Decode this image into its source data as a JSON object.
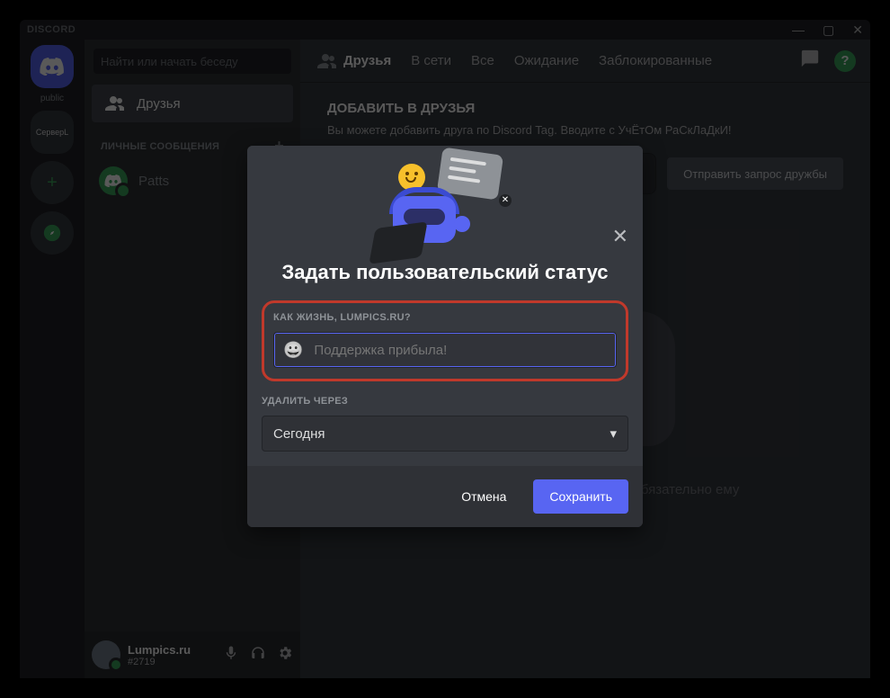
{
  "window": {
    "app_name": "DISCORD"
  },
  "guilds": {
    "home_label": "public",
    "server1": "СерверL"
  },
  "sidebar": {
    "search_placeholder": "Найти или начать беседу",
    "friends_label": "Друзья",
    "dm_header": "ЛИЧНЫЕ СООБЩЕНИЯ",
    "dm_items": [
      {
        "name": "Patts"
      }
    ]
  },
  "user": {
    "username": "Lumpics.ru",
    "tag": "#2719"
  },
  "topbar": {
    "friends": "Друзья",
    "online": "В сети",
    "all": "Все",
    "pending": "Ожидание",
    "blocked": "Заблокированные"
  },
  "add_friend": {
    "title": "ДОБАВИТЬ В ДРУЗЬЯ",
    "subtitle": "Вы можете добавить друга по Discord Tag. Вводите с УчЁтОм РаСкЛаДкИ!",
    "send_btn": "Отправить запрос дружбы"
  },
  "wumpus": {
    "text": "Вампус ждёт друзей. Но вам не обязательно ему\nуподобляться!"
  },
  "modal": {
    "title": "Задать пользовательский статус",
    "field_label": "КАК ЖИЗНЬ, LUMPICS.RU?",
    "placeholder": "Поддержка прибыла!",
    "clear_label": "УДАЛИТЬ ЧЕРЕЗ",
    "clear_value": "Сегодня",
    "cancel": "Отмена",
    "save": "Сохранить"
  }
}
